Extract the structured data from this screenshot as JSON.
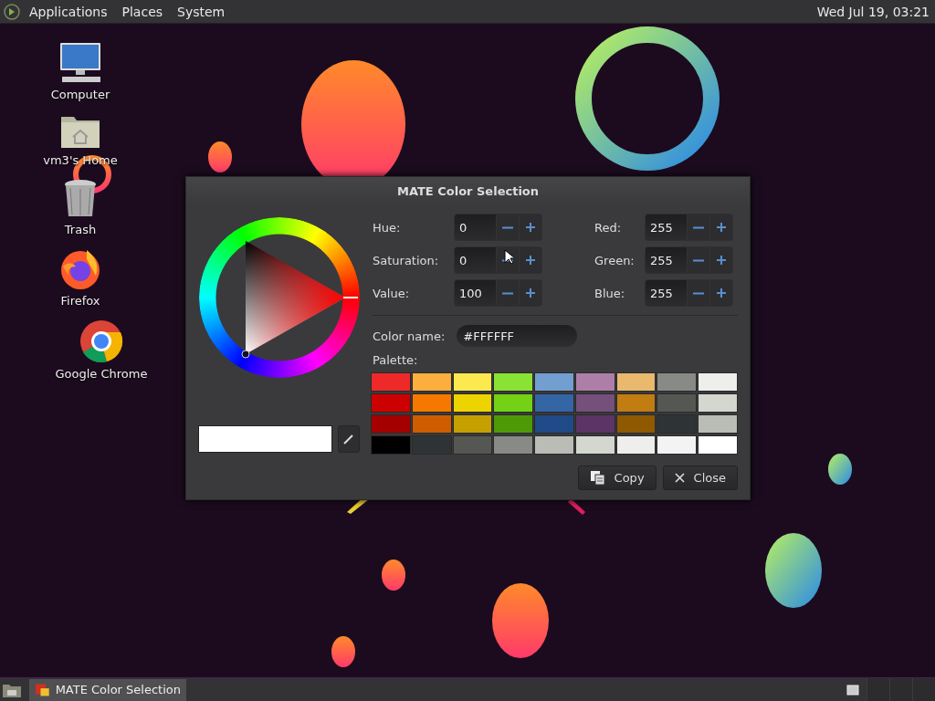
{
  "top_panel": {
    "menus": [
      "Applications",
      "Places",
      "System"
    ],
    "clock": "Wed Jul 19, 03:21"
  },
  "desktop_icons": [
    {
      "kind": "computer",
      "label": "Computer"
    },
    {
      "kind": "home",
      "label": "vm3's Home"
    },
    {
      "kind": "trash",
      "label": "Trash"
    },
    {
      "kind": "firefox",
      "label": "Firefox"
    },
    {
      "kind": "chrome",
      "label": "Google Chrome"
    }
  ],
  "dialog": {
    "title": "MATE Color Selection",
    "hsv_fields": [
      {
        "label": "Hue:",
        "value": "0"
      },
      {
        "label": "Saturation:",
        "value": "0"
      },
      {
        "label": "Value:",
        "value": "100"
      }
    ],
    "rgb_fields": [
      {
        "label": "Red:",
        "value": "255"
      },
      {
        "label": "Green:",
        "value": "255"
      },
      {
        "label": "Blue:",
        "value": "255"
      }
    ],
    "preview": {
      "color": "#ffffff"
    },
    "color_name": {
      "label": "Color name:",
      "value": "#FFFFFF"
    },
    "palette": {
      "label": "Palette:",
      "rows": [
        [
          {
            "color": "#ef2929"
          },
          {
            "color": "#fcaf3e"
          },
          {
            "color": "#fce94f"
          },
          {
            "color": "#8ae234"
          },
          {
            "color": "#729fcf"
          },
          {
            "color": "#ad7fa8"
          },
          {
            "color": "#e9b96e"
          },
          {
            "color": "#888a85"
          },
          {
            "color": "#eeeeec"
          }
        ],
        [
          {
            "color": "#cc0000"
          },
          {
            "color": "#f57900"
          },
          {
            "color": "#edd400"
          },
          {
            "color": "#73d216"
          },
          {
            "color": "#3465a4"
          },
          {
            "color": "#75507b"
          },
          {
            "color": "#c17d11"
          },
          {
            "color": "#555753"
          },
          {
            "color": "#d3d7cf"
          }
        ],
        [
          {
            "color": "#a40000"
          },
          {
            "color": "#ce5c00"
          },
          {
            "color": "#c4a000"
          },
          {
            "color": "#4e9a06"
          },
          {
            "color": "#204a87"
          },
          {
            "color": "#5c3566"
          },
          {
            "color": "#8f5902"
          },
          {
            "color": "#2e3436"
          },
          {
            "color": "#babdb6"
          }
        ],
        [
          {
            "color": "#000000"
          },
          {
            "color": "#2e3436"
          },
          {
            "color": "#555753"
          },
          {
            "color": "#888a85"
          },
          {
            "color": "#babdb6"
          },
          {
            "color": "#d3d7cf"
          },
          {
            "color": "#eeeeec"
          },
          {
            "color": "#f3f3f3"
          },
          {
            "color": "#ffffff"
          }
        ]
      ]
    },
    "buttons": [
      {
        "kind": "copy",
        "label": "Copy"
      },
      {
        "kind": "close",
        "label": "Close"
      }
    ]
  },
  "taskbar": {
    "windows": [
      {
        "title": "MATE Color Selection",
        "selected": true
      }
    ]
  }
}
